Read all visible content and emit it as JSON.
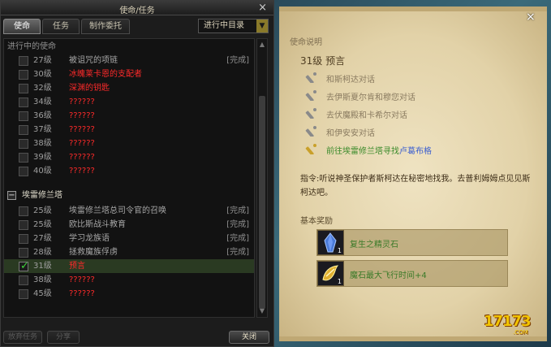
{
  "quest_window": {
    "title": "使命/任务",
    "close_symbol": "×",
    "tabs": [
      "使命",
      "任务",
      "制作委托"
    ],
    "active_tab": 0,
    "filter_dropdown": "进行中目录",
    "section_in_progress": "进行中的使命",
    "rows_top": [
      {
        "level": "27级",
        "name": "被诅咒的项链",
        "status": "[完成]",
        "red": false,
        "checked": false
      },
      {
        "level": "30级",
        "name": "冰魄莱卡恩的支配者",
        "status": "",
        "red": true,
        "checked": false
      },
      {
        "level": "32级",
        "name": "深渊的钥匙",
        "status": "",
        "red": true,
        "checked": false
      },
      {
        "level": "34级",
        "name": "??????",
        "status": "",
        "red": true,
        "checked": false
      },
      {
        "level": "36级",
        "name": "??????",
        "status": "",
        "red": true,
        "checked": false
      },
      {
        "level": "37级",
        "name": "??????",
        "status": "",
        "red": true,
        "checked": false
      },
      {
        "level": "38级",
        "name": "??????",
        "status": "",
        "red": true,
        "checked": false
      },
      {
        "level": "39级",
        "name": "??????",
        "status": "",
        "red": true,
        "checked": false
      },
      {
        "level": "40级",
        "name": "??????",
        "status": "",
        "red": true,
        "checked": false
      }
    ],
    "group_title": "埃雷修兰塔",
    "group_toggle": "−",
    "rows_group": [
      {
        "level": "25级",
        "name": "埃雷修兰塔总司令官的召唤",
        "status": "[完成]",
        "red": false,
        "checked": false
      },
      {
        "level": "25级",
        "name": "欧比斯战斗教育",
        "status": "[完成]",
        "red": false,
        "checked": false
      },
      {
        "level": "27级",
        "name": "学习龙族语",
        "status": "[完成]",
        "red": false,
        "checked": false
      },
      {
        "level": "28级",
        "name": "拯救魔族俘虏",
        "status": "[完成]",
        "red": false,
        "checked": false
      },
      {
        "level": "31级",
        "name": "预言",
        "status": "",
        "red": true,
        "checked": true
      },
      {
        "level": "38级",
        "name": "??????",
        "status": "",
        "red": true,
        "checked": false
      },
      {
        "level": "45级",
        "name": "??????",
        "status": "",
        "red": true,
        "checked": false
      }
    ],
    "bottom_buttons": [
      "放弃任务",
      "分享",
      "关闭"
    ]
  },
  "detail_panel": {
    "close_symbol": "×",
    "desc_label": "使命说明",
    "quest_title": "31级 预言",
    "objectives": [
      {
        "text": "和斯柯达对话",
        "link": "",
        "active": false
      },
      {
        "text": "去伊斯夏尔肯和穆您对话",
        "link": "",
        "active": false
      },
      {
        "text": "去伏魔殿和卡希尔对话",
        "link": "",
        "active": false
      },
      {
        "text": "和伊安安对话",
        "link": "",
        "active": false
      },
      {
        "text": "前往埃雷修兰塔寻找",
        "link": "卢葛布格",
        "active": true
      }
    ],
    "instructions": "指令:听说神圣保护者斯柯达在秘密地找我。去普利姆姆点见见斯柯达吧。",
    "reward_label": "基本奖励",
    "rewards": [
      {
        "name": "复生之精灵石",
        "count": "1",
        "icon": "crystal-icon"
      },
      {
        "name": "魔石最大飞行时间+4",
        "count": "1",
        "icon": "wing-stone-icon"
      }
    ]
  },
  "watermark": {
    "text": "17173",
    "sub": ".COM"
  },
  "colors": {
    "red": "#ff2a2a",
    "green": "#3a8a2a",
    "link": "#3c5fd0"
  }
}
